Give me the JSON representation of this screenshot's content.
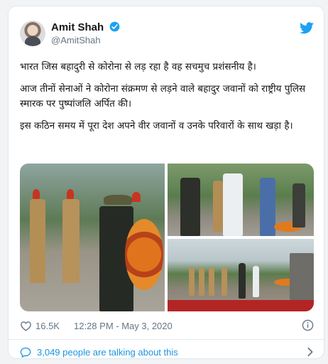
{
  "tweet": {
    "author_name": "Amit Shah",
    "author_handle": "@AmitShah",
    "paragraphs": [
      "भारत जिस बहादुरी से कोरोना से लड़ रहा है वह सचमुच प्रशंसनीय है।",
      "आज तीनों सेनाओं ने कोरोना संक्रमण से लड़ने वाले बहादुर जवानों को राष्ट्रीय पुलिस स्मारक पर पुष्पांजलि अर्पित की।",
      "इस कठिन समय में पूरा देश अपने वीर जवानों व उनके परिवारों के साथ खड़ा है।"
    ],
    "likes": "16.5K",
    "timestamp": "12:28 PM - May 3, 2020",
    "talking": "3,049 people are talking about this"
  },
  "icons": {
    "verified": "verified-badge-icon",
    "brand": "twitter-bird-icon",
    "like": "heart-icon",
    "info": "info-icon",
    "conversation": "chat-bubble-icon",
    "chevron": "chevron-right-icon"
  },
  "colors": {
    "brand_blue": "#1da1f2",
    "link_blue": "#1b95e0",
    "muted": "#657786",
    "text": "#14171a"
  }
}
